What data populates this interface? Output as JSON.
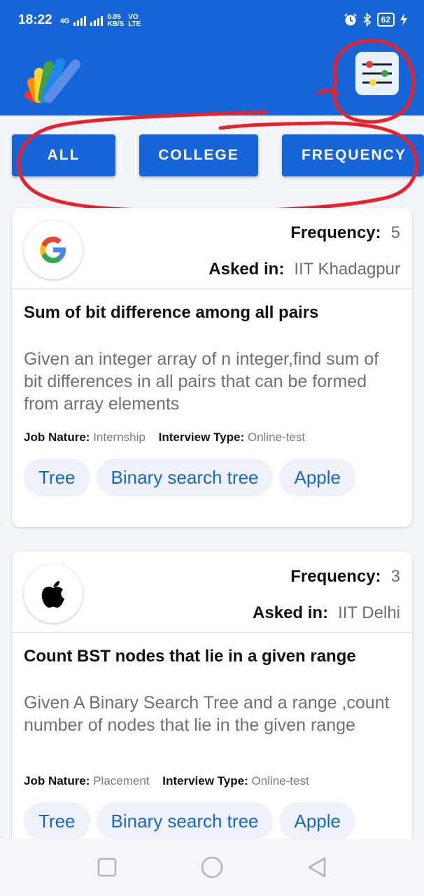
{
  "status_bar": {
    "time": "18:22",
    "net_4g": "4G",
    "speed_value": "0.05",
    "speed_unit": "KB/S",
    "volte_top": "VO",
    "volte_bottom": "LTE",
    "battery": "62",
    "icons": [
      "alarm-icon",
      "bluetooth-icon",
      "battery-icon",
      "charging-icon"
    ]
  },
  "app_bar": {
    "logo_icon": "peacock-fan-logo",
    "filter_icon": "sliders-icon"
  },
  "filters": {
    "all": "ALL",
    "college": "COLLEGE",
    "frequency": "FREQUENCY"
  },
  "labels": {
    "frequency": "Frequency:",
    "asked_in": "Asked in:",
    "job_nature": "Job Nature:",
    "interview_type": "Interview Type:"
  },
  "questions": [
    {
      "company_icon": "google-icon",
      "frequency": "5",
      "asked_in": "IIT Khadagpur",
      "title": "Sum of bit difference among all pairs",
      "description": "Given an integer array of n integer,find sum of bit differences in all pairs that can be formed from array elements",
      "job_nature": "Internship",
      "interview_type": "Online-test",
      "tags": [
        "Tree",
        "Binary search tree",
        "Apple"
      ]
    },
    {
      "company_icon": "apple-icon",
      "frequency": "3",
      "asked_in": "IIT Delhi",
      "title": "Count BST nodes that lie in a given range",
      "description": "Given A Binary Search Tree and a range ,count number of nodes that lie in the given range",
      "job_nature": "Placement",
      "interview_type": "Online-test",
      "tags": [
        "Tree",
        "Binary search tree",
        "Apple"
      ]
    }
  ],
  "colors": {
    "primary": "#1565d8",
    "tag_text": "#1a66c8",
    "tag_bg": "#eef1f7",
    "annotation": "#e8222a"
  },
  "nav_bar": {
    "icons": [
      "recents-square-icon",
      "home-circle-icon",
      "back-triangle-icon"
    ]
  }
}
